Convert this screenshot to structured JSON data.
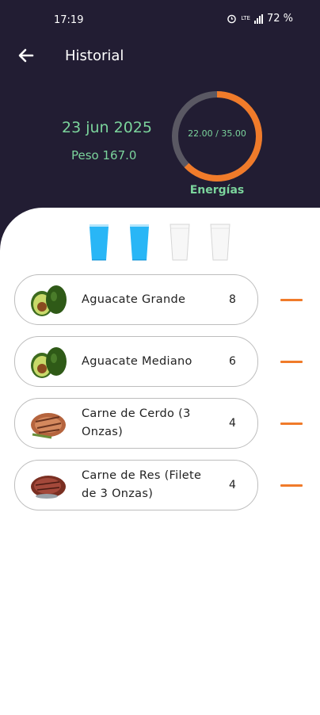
{
  "status_bar": {
    "time": "17:19",
    "battery": "72 %",
    "network_label": "LTE",
    "icons": [
      "alarm-icon",
      "signal-icon"
    ]
  },
  "app_bar": {
    "title": "Historial",
    "back_icon": "arrow-left-icon"
  },
  "summary": {
    "date": "23 jun 2025",
    "weight": "Peso 167.0",
    "energy_progress": "22.00 / 35.00",
    "energy_value": 22.0,
    "energy_max": 35.0,
    "energy_label": "Energías",
    "ring_color": "#f07b2a",
    "ring_track_color": "#5a5863",
    "accent_color": "#7bd49c"
  },
  "water": {
    "glasses": [
      {
        "filled": true
      },
      {
        "filled": true
      },
      {
        "filled": false
      },
      {
        "filled": false
      }
    ],
    "filled_color": "#29b6f6"
  },
  "foods": [
    {
      "name": "Aguacate Grande",
      "qty": "8",
      "icon": "avocado-icon"
    },
    {
      "name": "Aguacate Mediano",
      "qty": "6",
      "icon": "avocado-icon"
    },
    {
      "name": "Carne de Cerdo (3 Onzas)",
      "qty": "4",
      "icon": "pork-meat-icon"
    },
    {
      "name": "Carne de Res (Filete de 3 Onzas)",
      "qty": "4",
      "icon": "beef-steak-icon"
    }
  ],
  "remove_color": "#f07b2a"
}
